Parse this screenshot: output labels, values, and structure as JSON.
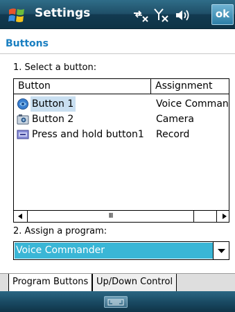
{
  "titlebar": {
    "title": "Settings",
    "ok_label": "ok",
    "icons": [
      "windows-start-icon",
      "connectivity-icon",
      "signal-off-icon",
      "speaker-icon"
    ]
  },
  "section_title": "Buttons",
  "select_label": "1. Select a button:",
  "table": {
    "columns": [
      "Button",
      "Assignment"
    ],
    "rows": [
      {
        "name": "Button 1",
        "assignment": "Voice Comman",
        "icon": "voice-button-icon",
        "selected": true
      },
      {
        "name": "Button 2",
        "assignment": "Camera",
        "icon": "camera-button-icon",
        "selected": false
      },
      {
        "name": "Press and hold button1",
        "assignment": "Record",
        "icon": "record-button-icon",
        "selected": false
      }
    ]
  },
  "assign_label": "2. Assign a program:",
  "program_select": {
    "value": "Voice Commander"
  },
  "tabs": [
    {
      "label": "Program Buttons",
      "active": true
    },
    {
      "label": "Up/Down Control",
      "active": false
    }
  ],
  "scrollbar_thumb_label": "III",
  "colors": {
    "accent": "#1a7fc1",
    "selection": "#3ab6d6",
    "titlebar": "#1f4f68"
  }
}
